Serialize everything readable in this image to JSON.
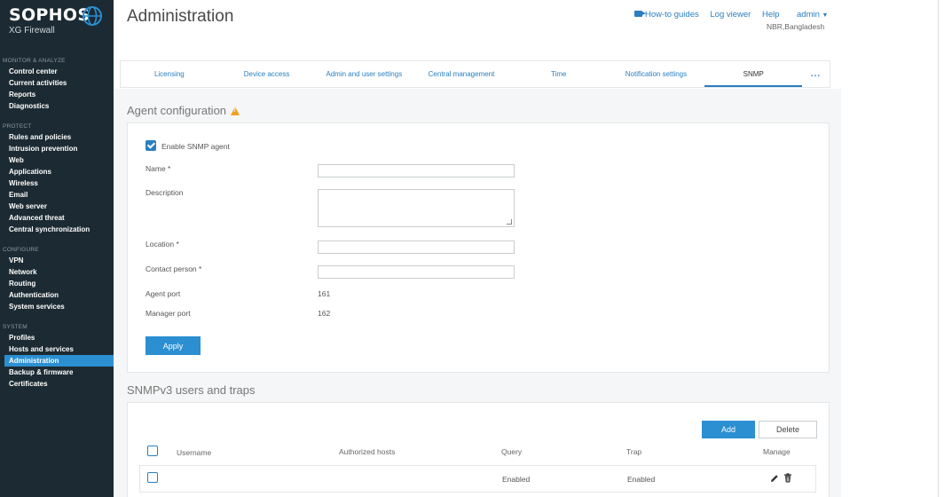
{
  "brand": {
    "name": "SOPHOS",
    "product": "XG Firewall"
  },
  "sidebar": {
    "sections": [
      {
        "title": "MONITOR & ANALYZE",
        "items": [
          "Control center",
          "Current activities",
          "Reports",
          "Diagnostics"
        ]
      },
      {
        "title": "PROTECT",
        "items": [
          "Rules and policies",
          "Intrusion prevention",
          "Web",
          "Applications",
          "Wireless",
          "Email",
          "Web server",
          "Advanced threat",
          "Central synchronization"
        ]
      },
      {
        "title": "CONFIGURE",
        "items": [
          "VPN",
          "Network",
          "Routing",
          "Authentication",
          "System services"
        ]
      },
      {
        "title": "SYSTEM",
        "items": [
          "Profiles",
          "Hosts and services",
          "Administration",
          "Backup & firmware",
          "Certificates"
        ]
      }
    ],
    "active_item": "Administration"
  },
  "header": {
    "title": "Administration",
    "links": {
      "howto": "How-to guides",
      "logviewer": "Log viewer",
      "help": "Help"
    },
    "user": "admin",
    "location": "NBR,Bangladesh"
  },
  "tabs": [
    "Licensing",
    "Device access",
    "Admin and user settings",
    "Central management",
    "Time",
    "Notification settings",
    "SNMP",
    "..."
  ],
  "active_tab": "SNMP",
  "agent": {
    "title": "Agent configuration",
    "enable_label": "Enable SNMP agent",
    "enabled": true,
    "name_label": "Name *",
    "name_value": "",
    "description_label": "Description",
    "description_value": "",
    "location_label": "Location *",
    "location_value": "",
    "contact_label": "Contact person *",
    "contact_value": "",
    "agent_port_label": "Agent port",
    "agent_port": "161",
    "manager_port_label": "Manager port",
    "manager_port": "162",
    "apply_label": "Apply"
  },
  "snmpv3": {
    "title": "SNMPv3 users and traps",
    "add_label": "Add",
    "delete_label": "Delete",
    "columns": {
      "username": "Username",
      "hosts": "Authorized hosts",
      "query": "Query",
      "trap": "Trap",
      "manage": "Manage"
    },
    "rows": [
      {
        "username": "",
        "hosts": "",
        "query": "Enabled",
        "trap": "Enabled"
      }
    ]
  },
  "colors": {
    "sidebar_bg": "#1c2b33",
    "accent": "#2b8fd1",
    "warning": "#f0a020"
  }
}
